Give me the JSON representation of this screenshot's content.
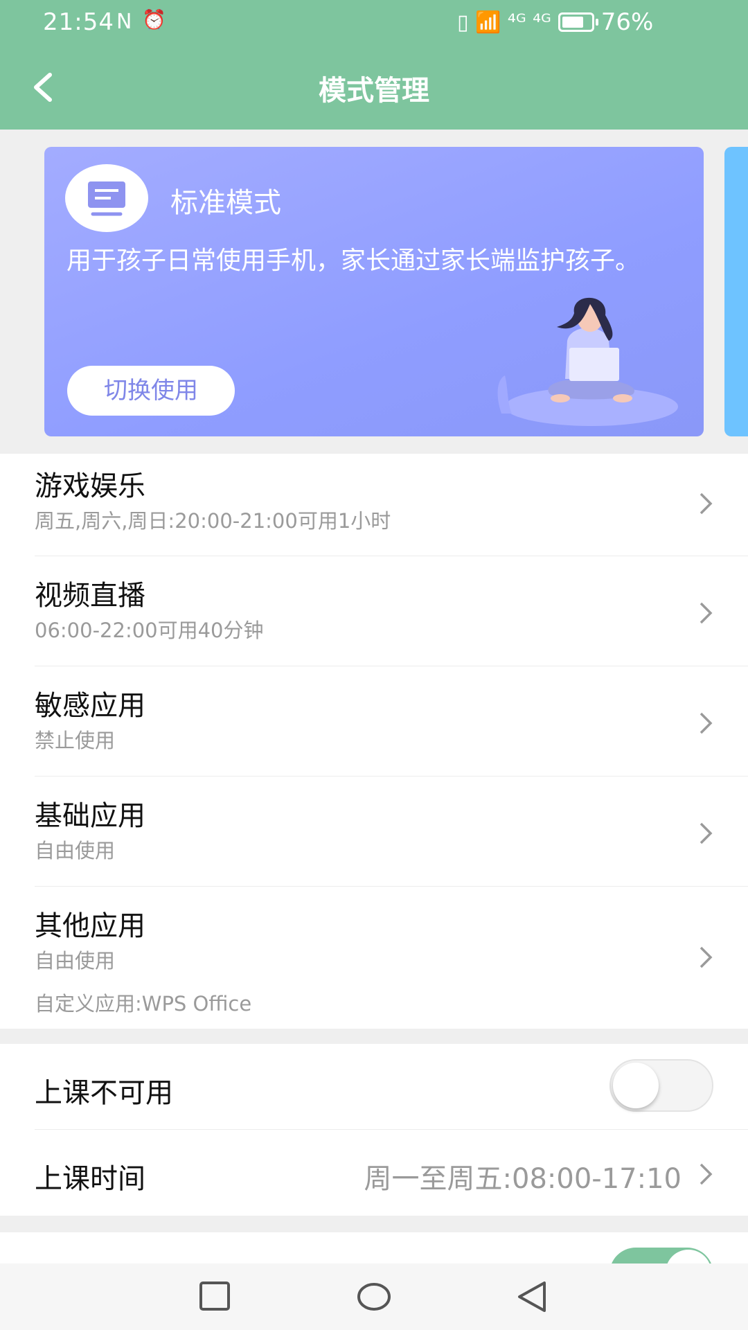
{
  "status_bar": {
    "time": "21:54",
    "nfc_icon": "N",
    "alarm_icon": "⏰",
    "signal_icons": "▯ 📶 ⁴ᴳ ⁴ᴳ",
    "battery_percent": "76%",
    "battery_level": 0.76
  },
  "header": {
    "title": "模式管理",
    "back_icon": "chevron-left-icon"
  },
  "mode_card": {
    "title": "标准模式",
    "description": "用于孩子日常使用手机，家长通过家长端监护孩子。",
    "switch_button": "切换使用"
  },
  "app_rules": [
    {
      "title": "游戏娱乐",
      "subtitle": "周五,周六,周日:20:00-21:00可用1小时"
    },
    {
      "title": "视频直播",
      "subtitle": "06:00-22:00可用40分钟"
    },
    {
      "title": "敏感应用",
      "subtitle": "禁止使用"
    },
    {
      "title": "基础应用",
      "subtitle": "自由使用"
    },
    {
      "title": "其他应用",
      "subtitle": "自由使用",
      "extra": "自定义应用:WPS Office"
    }
  ],
  "class_settings": {
    "unavailable_label": "上课不可用",
    "unavailable_enabled": false,
    "time_label": "上课时间",
    "time_value": "周一至周五:08:00-17:10"
  },
  "next_section": {
    "toggle_enabled": true
  },
  "nav_bar": {
    "items": [
      "recent-apps-square-icon",
      "home-circle-icon",
      "back-triangle-icon"
    ]
  },
  "colors": {
    "header_green": "#7ec59e",
    "card_purple": "#9aa5ff",
    "switch_text": "#7f86e8"
  }
}
